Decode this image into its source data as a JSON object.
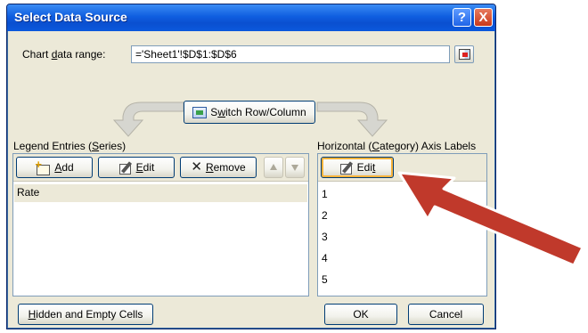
{
  "dialog": {
    "title": "Select Data Source",
    "help_glyph": "?",
    "close_glyph": "X"
  },
  "range": {
    "label_pre": "Chart ",
    "label_accel": "d",
    "label_post": "ata range:",
    "value": "='Sheet1'!$D$1:$D$6"
  },
  "switch_button": {
    "pre": "S",
    "accel": "w",
    "post": "itch Row/Column"
  },
  "legend": {
    "label_pre": "Legend Entries (",
    "label_accel": "S",
    "label_post": "eries)",
    "add_accel": "A",
    "add_post": "dd",
    "edit_accel": "E",
    "edit_post": "dit",
    "remove_accel": "R",
    "remove_post": "emove",
    "items": [
      "Rate"
    ]
  },
  "category": {
    "label_pre": "Horizontal (",
    "label_accel": "C",
    "label_post": "ategory) Axis Labels",
    "edit_pre": "Edi",
    "edit_accel": "t",
    "items": [
      "1",
      "2",
      "3",
      "4",
      "5"
    ]
  },
  "footer": {
    "hidden_accel": "H",
    "hidden_post": "idden and Empty Cells",
    "ok_label": "OK",
    "cancel_label": "Cancel"
  },
  "colors": {
    "title_bar": "#0a4fd0",
    "dialog_bg": "#ece9d8",
    "annotation_arrow": "#c0392b"
  }
}
